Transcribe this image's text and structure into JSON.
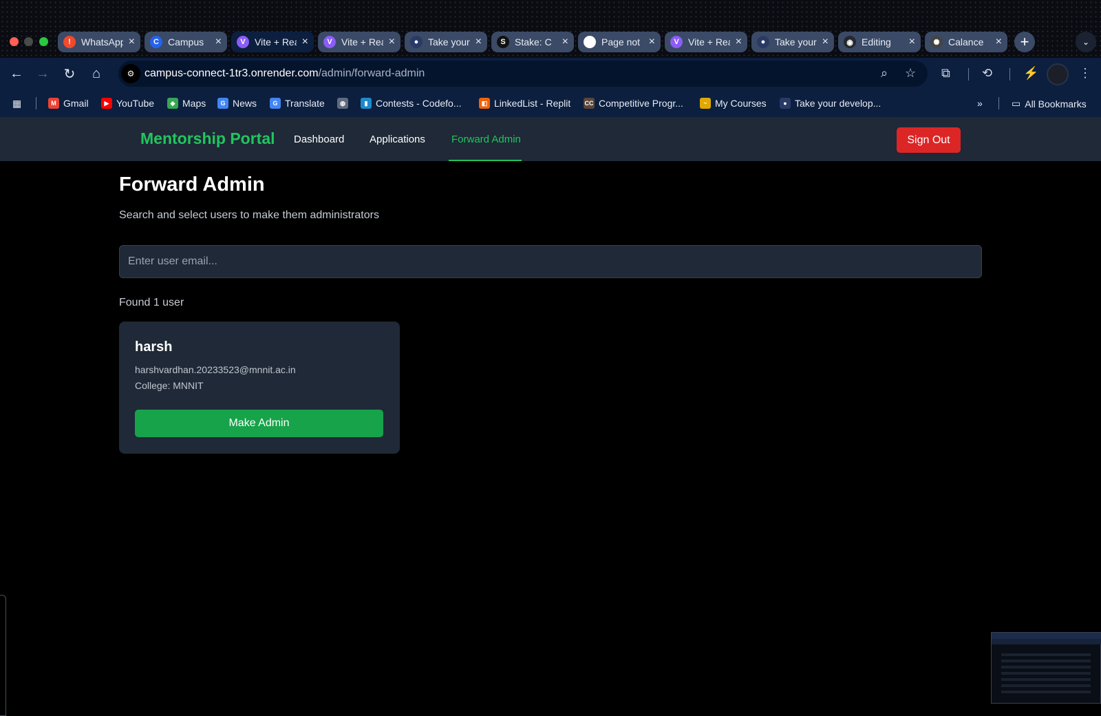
{
  "browser": {
    "tabs": [
      {
        "label": "WhatsApp",
        "favicon": "alert-icon",
        "color": "#f04a2c",
        "glyph": "!"
      },
      {
        "label": "Campus",
        "favicon": "campus-icon",
        "color": "#2563eb",
        "glyph": "C"
      },
      {
        "label": "Vite + React",
        "favicon": "vite-icon",
        "color": "#8b5cf6",
        "glyph": "V",
        "active": true
      },
      {
        "label": "Vite + React",
        "favicon": "vite-icon",
        "color": "#8b5cf6",
        "glyph": "V"
      },
      {
        "label": "Take your",
        "favicon": "avatar-icon",
        "color": "#2a3a66",
        "glyph": "●"
      },
      {
        "label": "Stake: C",
        "favicon": "stake-icon",
        "color": "#111111",
        "glyph": "S"
      },
      {
        "label": "Page not",
        "favicon": "page-icon",
        "color": "#ffffff",
        "glyph": "▮"
      },
      {
        "label": "Vite + React",
        "favicon": "vite-icon",
        "color": "#8b5cf6",
        "glyph": "V"
      },
      {
        "label": "Take your",
        "favicon": "avatar-icon",
        "color": "#2a3a66",
        "glyph": "●"
      },
      {
        "label": "Editing",
        "favicon": "github-icon",
        "color": "#24292f",
        "glyph": "◉"
      },
      {
        "label": "Calance",
        "favicon": "openai-icon",
        "color": "#444444",
        "glyph": "✺"
      }
    ],
    "url_domain": "campus-connect-1tr3.onrender.com",
    "url_path": "/admin/forward-admin",
    "bookmarks": [
      {
        "label": "Gmail",
        "icon": "gmail-icon",
        "color": "#ea4335",
        "glyph": "M"
      },
      {
        "label": "YouTube",
        "icon": "youtube-icon",
        "color": "#ff0000",
        "glyph": "▶"
      },
      {
        "label": "Maps",
        "icon": "maps-icon",
        "color": "#34a853",
        "glyph": "◆"
      },
      {
        "label": "News",
        "icon": "news-icon",
        "color": "#4285f4",
        "glyph": "G"
      },
      {
        "label": "Translate",
        "icon": "translate-icon",
        "color": "#4285f4",
        "glyph": "G"
      },
      {
        "label": "",
        "icon": "globe-icon",
        "color": "#5f6b7e",
        "glyph": "◍"
      },
      {
        "label": "Contests - Codefo...",
        "icon": "codeforces-icon",
        "color": "#1f8acb",
        "glyph": "▮"
      },
      {
        "label": "LinkedList - Replit",
        "icon": "replit-icon",
        "color": "#f26207",
        "glyph": "◧"
      },
      {
        "label": "Competitive Progr...",
        "icon": "codechef-icon",
        "color": "#5b4638",
        "glyph": "CC"
      },
      {
        "label": "My Courses",
        "icon": "courses-icon",
        "color": "#e0a800",
        "glyph": "~"
      },
      {
        "label": "Take your develop...",
        "icon": "avatar-icon",
        "color": "#2a3a66",
        "glyph": "●"
      }
    ],
    "all_bookmarks": "All Bookmarks"
  },
  "app": {
    "brand": "Mentorship Portal",
    "nav": [
      "Dashboard",
      "Applications",
      "Forward Admin"
    ],
    "active_nav": "Forward Admin",
    "sign_out": "Sign Out",
    "title": "Forward Admin",
    "subtitle": "Search and select users to make them administrators",
    "search_placeholder": "Enter user email...",
    "result_count": "Found 1 user",
    "users": [
      {
        "name": "harsh",
        "email": "harshvardhan.20233523@mnnit.ac.in",
        "college": "College: MNNIT",
        "action": "Make Admin"
      }
    ]
  },
  "colors": {
    "accent": "#22c55e",
    "danger": "#dc2626",
    "success": "#16a34a",
    "surface": "#1f2937"
  }
}
